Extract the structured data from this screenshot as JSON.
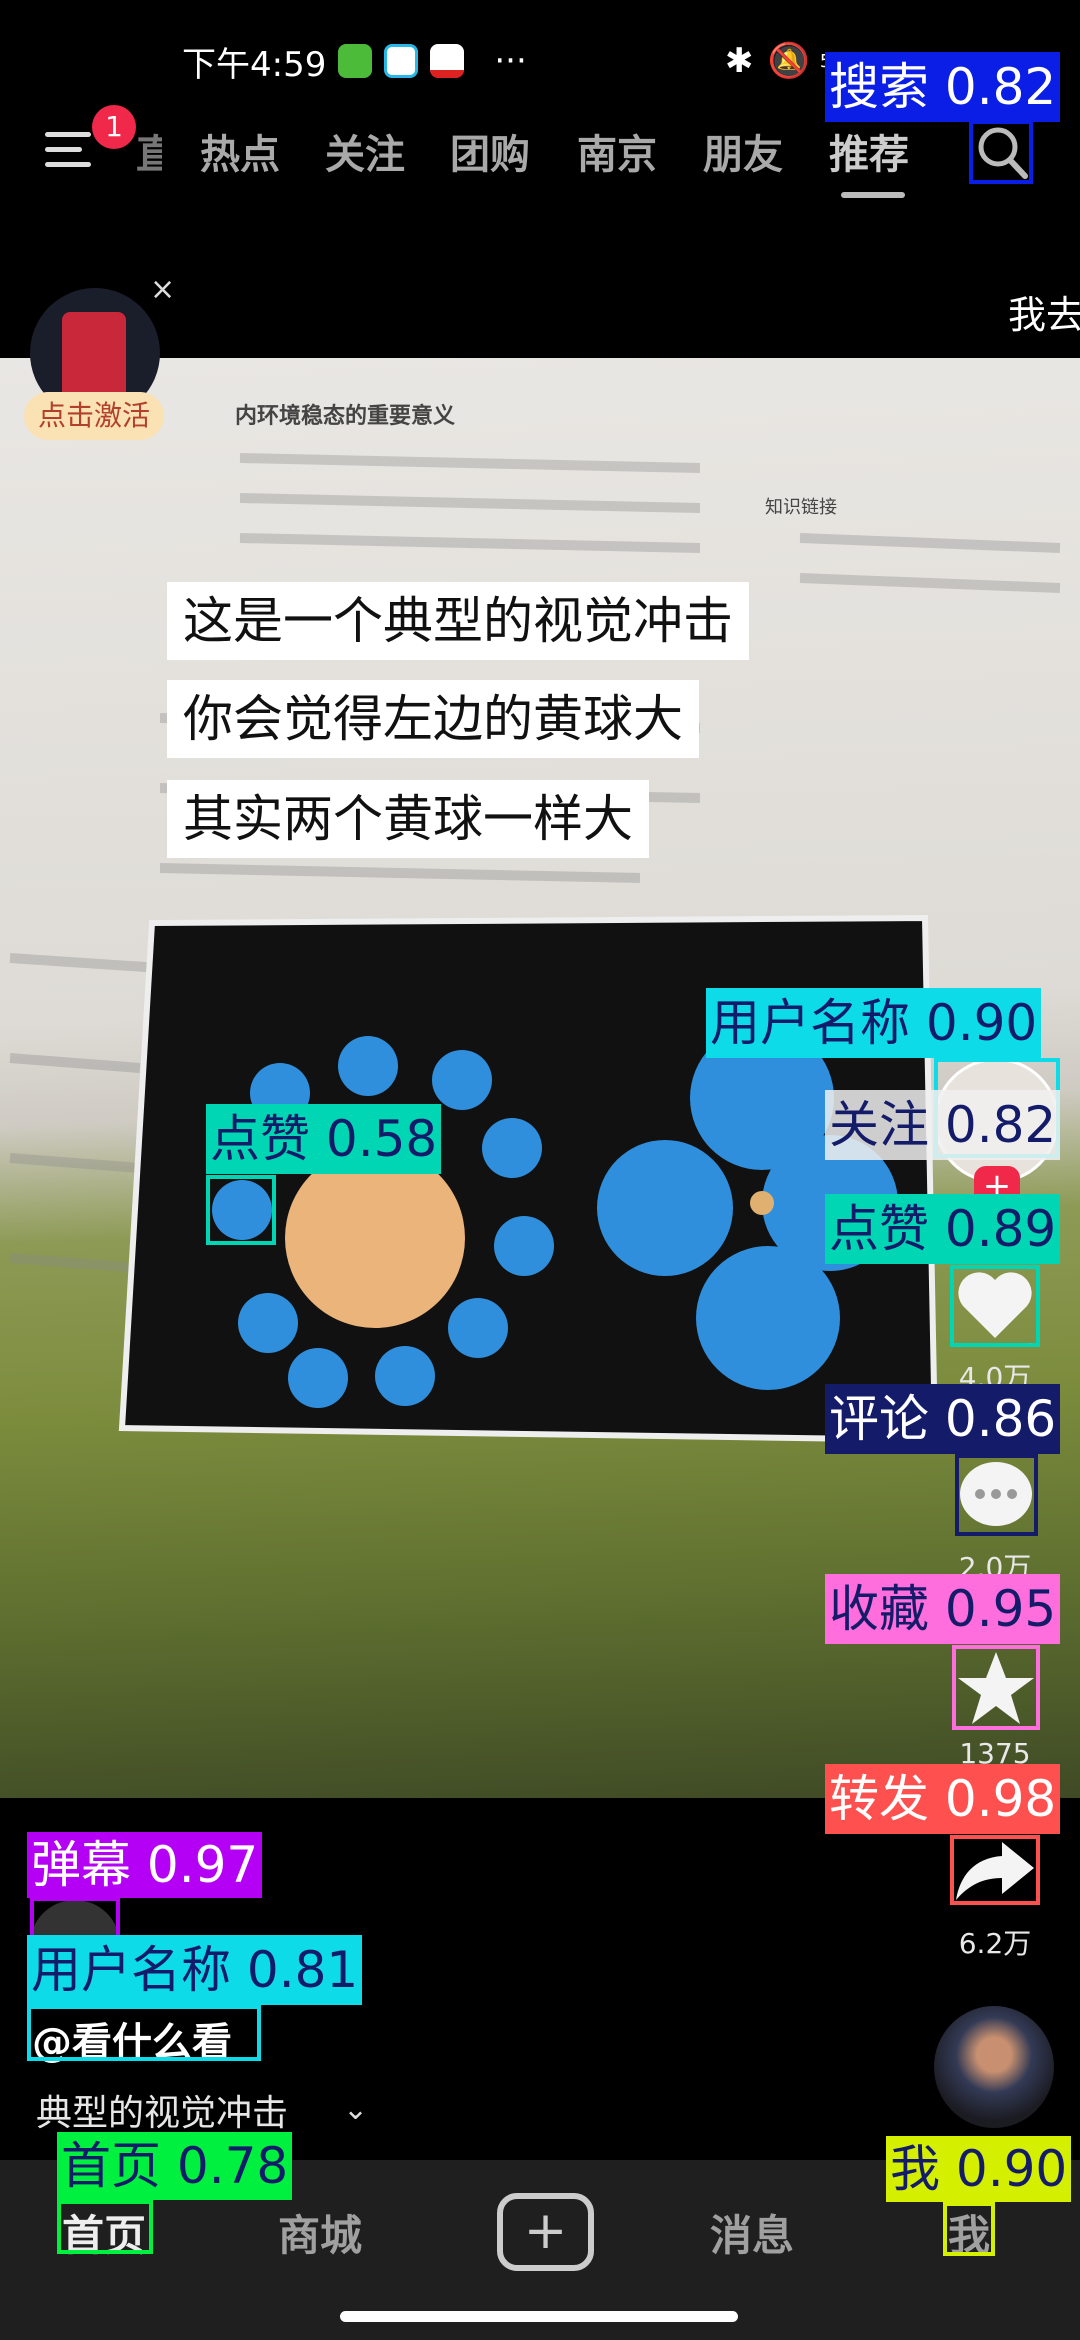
{
  "status_bar": {
    "time": "下午4:59",
    "more": "···",
    "network": "5G"
  },
  "top_tabs": {
    "badge": "1",
    "partial": "直",
    "items": [
      "热点",
      "关注",
      "团购",
      "南京",
      "朋友",
      "推荐"
    ],
    "active": "推荐"
  },
  "red_packet": {
    "label": "点击激活",
    "close": "×"
  },
  "marquee": "我去",
  "video": {
    "book_heading": "内环境稳态的重要意义",
    "book_side": "知识链接",
    "subtitles": [
      "这是一个典型的视觉冲击",
      "你会觉得左边的黄球大",
      "其实两个黄球一样大"
    ]
  },
  "side_actions": {
    "like_count": "4.0万",
    "comment_count": "2.0万",
    "favorite_count": "1375",
    "share_count": "6.2万"
  },
  "author": {
    "handle": "@看什么看",
    "caption": "典型的视觉冲击"
  },
  "bottom_nav": {
    "items": [
      "首页",
      "商城",
      "消息",
      "我"
    ],
    "active": "首页"
  },
  "detections": [
    {
      "label": "搜索 0.82",
      "color": "#0a1ee6"
    },
    {
      "label": "用户名称 0.90",
      "color": "#0edbe8"
    },
    {
      "label": "关注 0.82",
      "color": "#f0f0f0"
    },
    {
      "label": "点赞 0.89",
      "color": "#00d6b4"
    },
    {
      "label": "点赞 0.58",
      "color": "#00d6b4"
    },
    {
      "label": "评论 0.86",
      "color": "#141c6a"
    },
    {
      "label": "收藏 0.95",
      "color": "#ff6edc"
    },
    {
      "label": "转发 0.98",
      "color": "#ff5050"
    },
    {
      "label": "弹幕 0.97",
      "color": "#b400f5"
    },
    {
      "label": "用户名称 0.81",
      "color": "#0edbe8"
    },
    {
      "label": "首页 0.78",
      "color": "#00f040"
    },
    {
      "label": "我 0.90",
      "color": "#d4f000"
    }
  ]
}
